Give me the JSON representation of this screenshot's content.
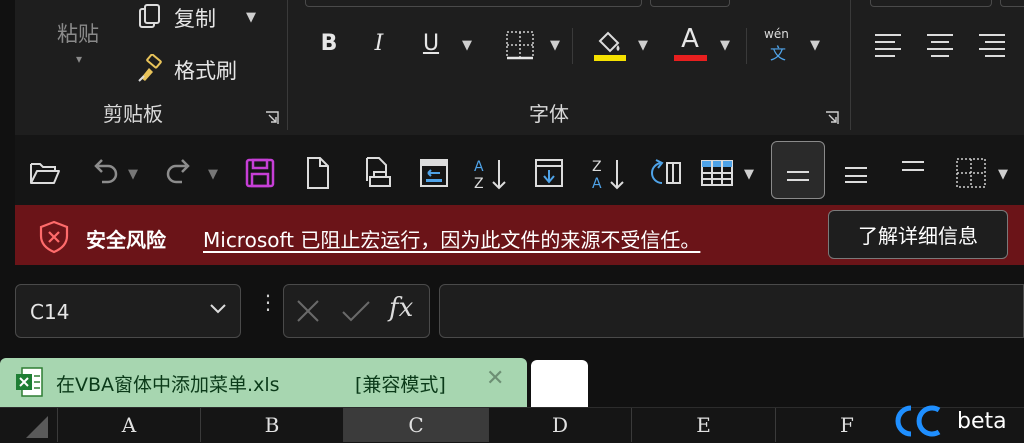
{
  "ribbon": {
    "clipboard": {
      "paste_label": "粘贴",
      "copy_label": "复制",
      "format_painter_label": "格式刷",
      "group_label": "剪贴板"
    },
    "font": {
      "group_label": "字体",
      "bold": "B",
      "italic": "I",
      "underline": "U",
      "font_color_glyph": "A",
      "phonetic_top": "wén",
      "phonetic_bottom": "文",
      "fill_color": "#f5e100",
      "font_color": "#e81f1f"
    }
  },
  "security": {
    "title": "安全风险",
    "message": "Microsoft 已阻止宏运行，因为此文件的来源不受信任。",
    "button_label": "了解详细信息",
    "bar_color": "#6b1418"
  },
  "formula_bar": {
    "name_box": "C14",
    "fx_label": "fx",
    "formula_value": ""
  },
  "workbook_tab": {
    "title": "在VBA窗体中添加菜单.xls",
    "mode": "[兼容模式]",
    "color": "#a7d6b0"
  },
  "columns": [
    "A",
    "B",
    "C",
    "D",
    "E",
    "F"
  ],
  "selected_column": "C",
  "brand": {
    "text": "beta"
  }
}
